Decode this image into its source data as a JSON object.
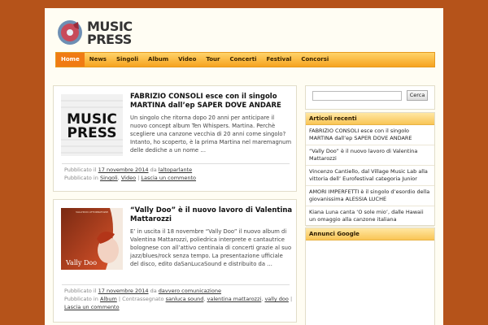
{
  "brand": {
    "line1": "MUSIC",
    "line2": "PRESS"
  },
  "nav": {
    "items": [
      "Home",
      "News",
      "Singoli",
      "Album",
      "Video",
      "Tour",
      "Concerti",
      "Festival",
      "Concorsi"
    ]
  },
  "posts": [
    {
      "thumb_text": {
        "line1": "MUSIC",
        "line2": "PRESS"
      },
      "title": "FABRIZIO CONSOLI esce con il singolo MARTINA dall’ep SAPER DOVE ANDARE",
      "excerpt": "Un singolo che ritorna dopo 20 anni per anticipare il nuovo concept album Ten Whispers. Martina. Perchè scegliere una canzone vecchia di 20 anni come singolo? Intanto, ho scoperto, è la prima Martina nel maremagnum delle dediche a un nome …",
      "published_prefix": "Pubblicato il",
      "date": "17 novembre 2014",
      "by": "da",
      "author": "laltoparlante",
      "cat_prefix": "Pubblicato in",
      "categories": [
        "Singoli",
        "Video"
      ],
      "comment": "Lascia un commento"
    },
    {
      "thumb_text": {
        "top": "VALLYDOO ATTORNATOZZI",
        "bottom": "Vally Doo"
      },
      "title": "“Vally Doo” è il nuovo lavoro di Valentina Mattarozzi",
      "excerpt": "E’ in uscita il 18 novembre “Vally Doo” il nuovo album di Valentina Mattarozzi, poliedrica interprete e cantautrice bolognese con all’attivo centinaia di concerti grazie al suo jazz/blues/rock senza tempo. La presentazione ufficiale del disco, edito daSanLucaSound e distribuito da …",
      "published_prefix": "Pubblicato il",
      "date": "17 novembre 2014",
      "by": "da",
      "author": "davvero comunicazione",
      "cat_prefix": "Pubblicato in",
      "categories": [
        "Album"
      ],
      "tag_prefix": "Contrassegnato",
      "tags": [
        "sanluca sound",
        "valentina mattarozzi",
        "vally doo"
      ],
      "comment": "Lascia un commento"
    }
  ],
  "sidebar": {
    "search_button": "Cerca",
    "recent_title": "Articoli recenti",
    "recent": [
      "FABRIZIO CONSOLI esce con il singolo MARTINA dall’ep SAPER DOVE ANDARE",
      "“Vally Doo” è il nuovo lavoro di Valentina Mattarozzi",
      "Vincenzo Cantiello, dal Village Music Lab alla vittoria dell’ Eurofestival categoria Junior",
      "AMORI IMPERFETTI è il singolo d’esordio della giovanissima ALESSIA LUCHE",
      "Kiana Luna canta ‘O sole mio’, dalle Hawaii un omaggio alla canzone italiana"
    ],
    "ads_title": "Annunci Google"
  },
  "colors": {
    "background": "#b5531a",
    "accent": "#f07b14",
    "nav": "#f6a320"
  }
}
